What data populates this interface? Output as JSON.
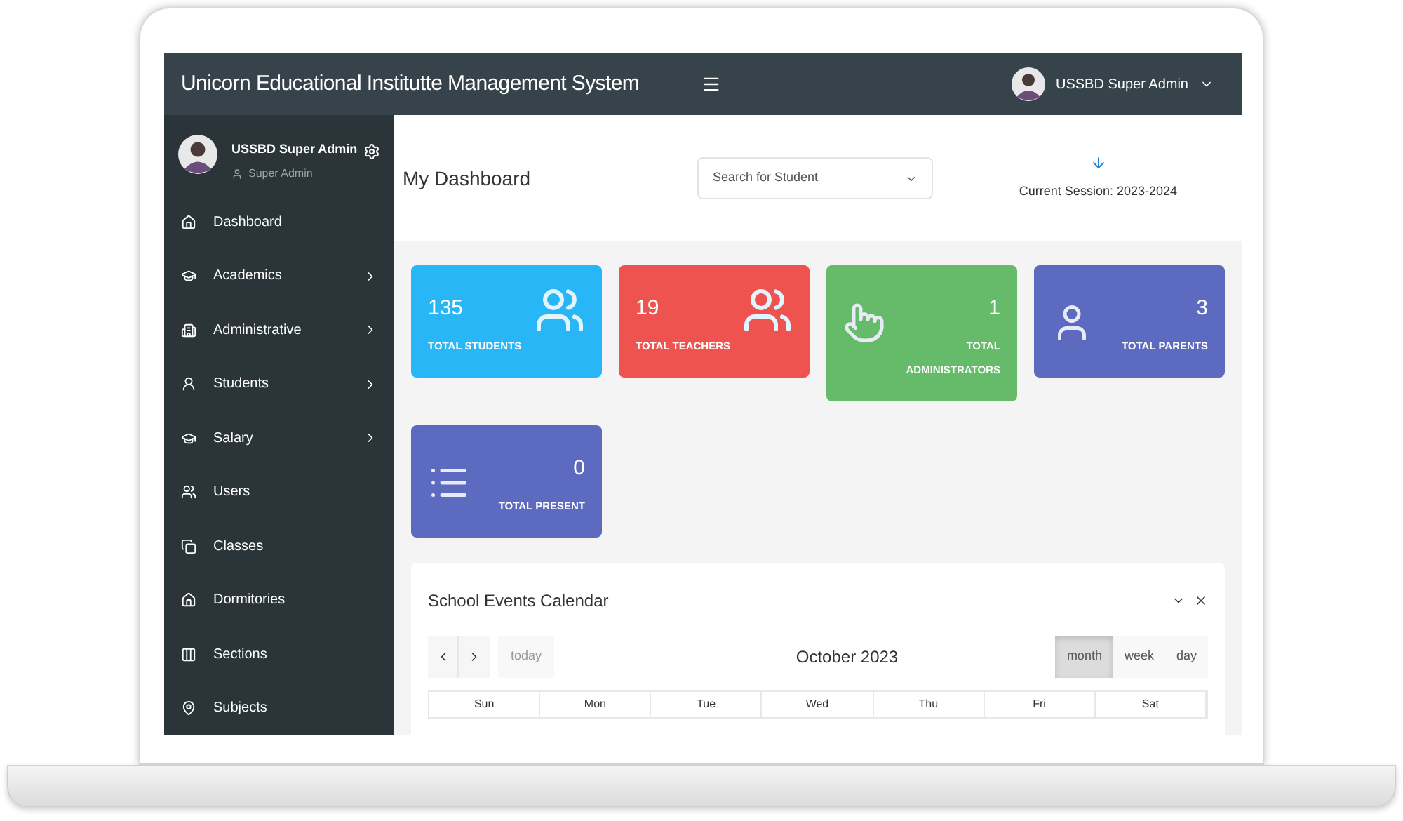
{
  "topbar": {
    "title": "Unicorn Educational Institutte Management System",
    "user": "USSBD Super Admin"
  },
  "sidebar": {
    "profile": {
      "name": "USSBD Super Admin",
      "role": "Super Admin"
    },
    "items": [
      {
        "label": "Dashboard",
        "has_submenu": false
      },
      {
        "label": "Academics",
        "has_submenu": true
      },
      {
        "label": "Administrative",
        "has_submenu": true
      },
      {
        "label": "Students",
        "has_submenu": true
      },
      {
        "label": "Salary",
        "has_submenu": true
      },
      {
        "label": "Users",
        "has_submenu": false
      },
      {
        "label": "Classes",
        "has_submenu": false
      },
      {
        "label": "Dormitories",
        "has_submenu": false
      },
      {
        "label": "Sections",
        "has_submenu": false
      },
      {
        "label": "Subjects",
        "has_submenu": false
      }
    ]
  },
  "header": {
    "title": "My Dashboard",
    "search": {
      "placeholder": "Search for Student"
    },
    "session": "Current Session: 2023-2024"
  },
  "stats": [
    {
      "value": "135",
      "label": "TOTAL STUDENTS",
      "color": "#29b6f6"
    },
    {
      "value": "19",
      "label": "TOTAL TEACHERS",
      "color": "#ef5350"
    },
    {
      "value": "1",
      "label": "TOTAL ADMINISTRATORS",
      "color": "#66bb6a"
    },
    {
      "value": "3",
      "label": "TOTAL PARENTS",
      "color": "#5c6bc0"
    },
    {
      "value": "0",
      "label": "TOTAL PRESENT",
      "color": "#5c6bc0"
    }
  ],
  "calendar": {
    "title": "School Events Calendar",
    "today": "today",
    "month": "October 2023",
    "views": [
      {
        "label": "month",
        "selected": true
      },
      {
        "label": "week",
        "selected": false
      },
      {
        "label": "day",
        "selected": false
      }
    ],
    "days": [
      "Sun",
      "Mon",
      "Tue",
      "Wed",
      "Thu",
      "Fri",
      "Sat"
    ]
  }
}
